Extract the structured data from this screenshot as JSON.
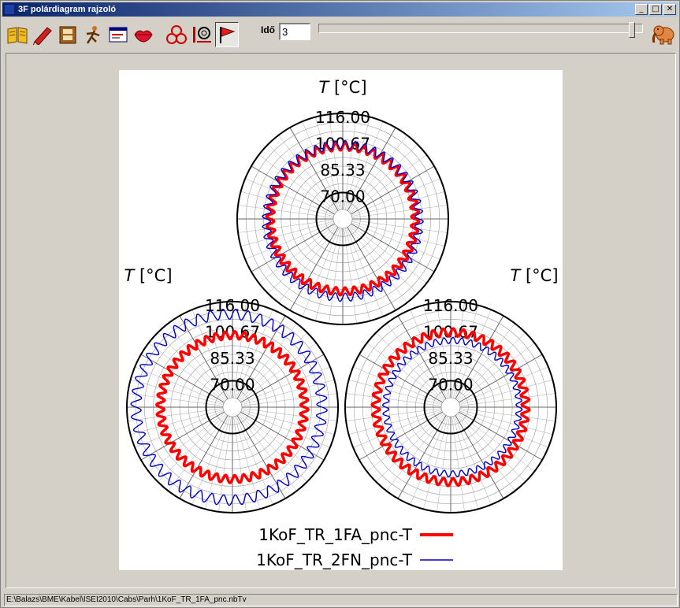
{
  "window": {
    "title": "3F polárdiagram rajzoló",
    "titlebar_color_start": "#0a246a",
    "titlebar_color_end": "#a6caf0",
    "minimize_glyph": "_",
    "maximize_glyph": "□",
    "close_glyph": "✕"
  },
  "toolbar": {
    "tools": [
      {
        "name": "open-book-icon",
        "pressed": false
      },
      {
        "name": "pencil-icon",
        "pressed": false
      },
      {
        "name": "film-icon",
        "pressed": false
      },
      {
        "name": "running-person-icon",
        "pressed": false
      },
      {
        "name": "window-edit-icon",
        "pressed": false
      },
      {
        "name": "lips-icon",
        "pressed": false
      },
      {
        "name": "three-circles-icon",
        "pressed": false
      },
      {
        "name": "phase-config-icon",
        "pressed": false
      },
      {
        "name": "flag-icon",
        "pressed": true
      }
    ],
    "time_label": "Idő",
    "time_value": "3",
    "slider_fraction": 0.975,
    "elephant_icon": "elephant-icon"
  },
  "status_bar": {
    "path": "E:\\Balazs\\BME\\Kabel\\ISEI2010\\Cabs\\Parh\\1KoF_TR_1FA_pnc.nbTv"
  },
  "chart_data": {
    "type": "polar",
    "layout": "three-phase",
    "axis_title_symbol": "T",
    "axis_title_unit": "[°C]",
    "radial_ticks": [
      "116.00",
      "100.67",
      "85.33",
      "70.00"
    ],
    "radial_range": [
      54.67,
      116
    ],
    "grid": true,
    "legend_position": "bottom",
    "series": [
      {
        "name": "1KoF_TR_1FA_pnc-T",
        "color": "#ff0000",
        "line": "thick",
        "phases": [
          {
            "mean": 96.8,
            "amplitude": 2.2,
            "cycles": 48
          },
          {
            "mean": 96.5,
            "amplitude": 2.2,
            "cycles": 48
          },
          {
            "mean": 98.2,
            "amplitude": 2.2,
            "cycles": 48
          }
        ]
      },
      {
        "name": "1KoF_TR_2FN_pnc-T",
        "color": "#0000cc",
        "line": "thin",
        "phases": [
          {
            "mean": 99.0,
            "amplitude": 2.4,
            "cycles": 48,
            "shape": "top-lobed"
          },
          {
            "mean": 108.7,
            "amplitude": 3.0,
            "cycles": 48,
            "shape": "left-lobed"
          },
          {
            "mean": 93.4,
            "amplitude": 1.8,
            "cycles": 48,
            "shape": "right-lobed"
          }
        ]
      }
    ]
  }
}
